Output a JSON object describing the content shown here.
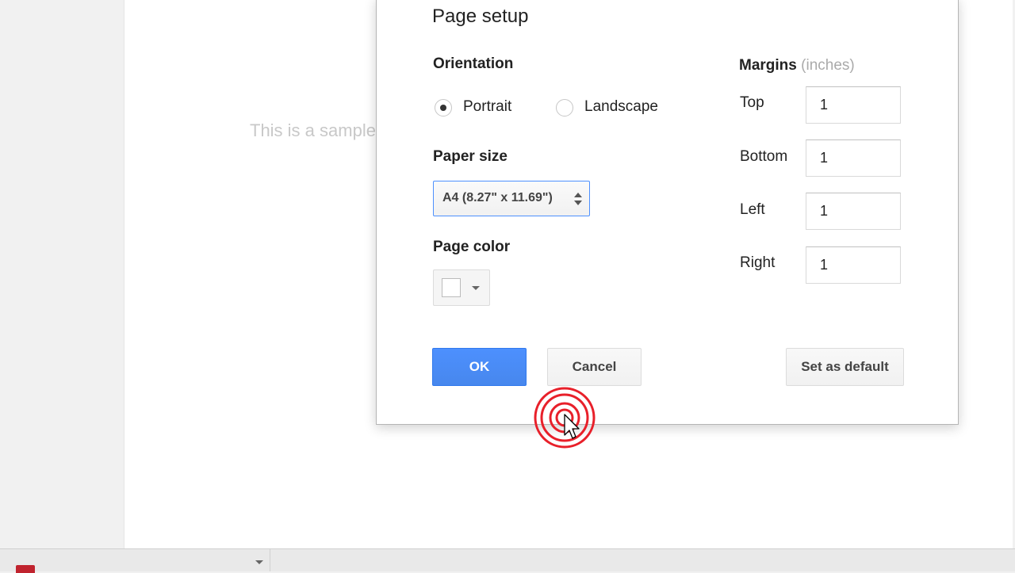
{
  "document": {
    "body_text": "This is a sample"
  },
  "dialog": {
    "title": "Page setup",
    "orientation": {
      "label": "Orientation",
      "options": [
        {
          "label": "Portrait",
          "selected": true
        },
        {
          "label": "Landscape",
          "selected": false
        }
      ]
    },
    "paper_size": {
      "label": "Paper size",
      "selected_value": "A4 (8.27\" x 11.69\")"
    },
    "page_color": {
      "label": "Page color",
      "value": "#ffffff"
    },
    "margins": {
      "label": "Margins",
      "unit": "(inches)",
      "fields": [
        {
          "label": "Top",
          "value": "1"
        },
        {
          "label": "Bottom",
          "value": "1"
        },
        {
          "label": "Left",
          "value": "1"
        },
        {
          "label": "Right",
          "value": "1"
        }
      ]
    },
    "buttons": {
      "ok": "OK",
      "cancel": "Cancel",
      "set_default": "Set as default"
    }
  },
  "colors": {
    "primary_button": "#4d90fe",
    "click_indicator": "#e8202a"
  }
}
